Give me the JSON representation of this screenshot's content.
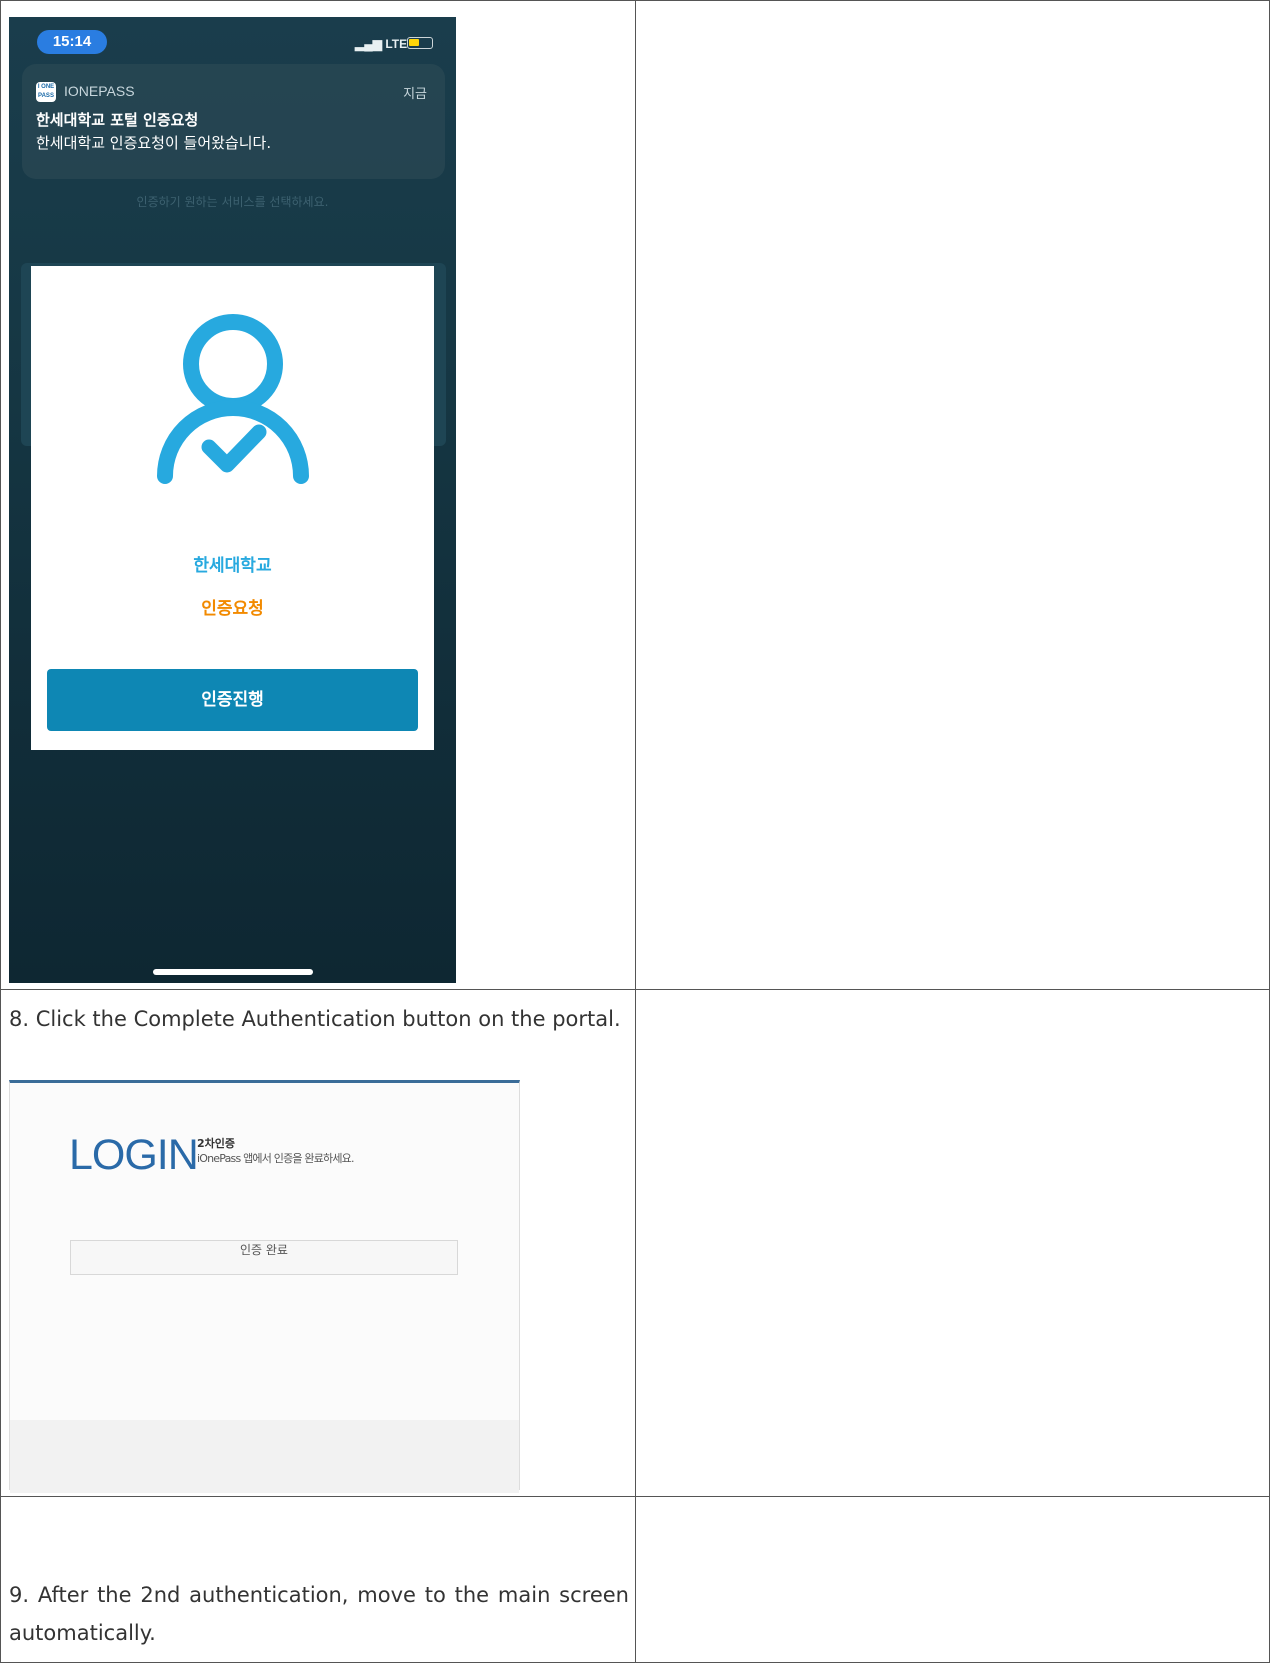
{
  "phone": {
    "status_time": "15:14",
    "signal_label": "LTE",
    "notification": {
      "app_name": "IONEPASS",
      "app_icon_text": "I ONE PASS",
      "time": "지금",
      "title": "한세대학교 포털 인증요청",
      "body": "한세대학교 인증요청이 들어왔습니다."
    },
    "background_hint": "인증하기 원하는 서비스를 선택하세요.",
    "modal": {
      "organization": "한세대학교",
      "request_label": "인증요청",
      "proceed_button": "인증진행"
    }
  },
  "steps": {
    "step8": "8. Click the Complete Authentication button on the portal.",
    "step9": "9. After the 2nd authentication, move to the main screen automatically."
  },
  "login": {
    "logo": "LOGIN",
    "subtitle": "2차인증",
    "instruction": "iOnePass 앱에서 인증을 완료하세요.",
    "complete_button": "인증 완료"
  },
  "colors": {
    "accent_blue": "#27a9df",
    "accent_orange": "#f28a00",
    "button_blue": "#0e87b4",
    "logo_blue": "#2a6aa8"
  }
}
